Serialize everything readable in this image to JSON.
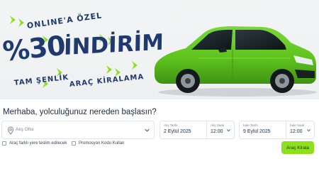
{
  "promo": {
    "line_top": "ONLINE'A ÖZEL",
    "percent": "%30",
    "word": "İNDİRİM",
    "line_bottom_left": "TAM ŞENLİK",
    "line_bottom_right": "ARAÇ KİRALAMA"
  },
  "booking": {
    "greeting": "Merhaba, yolculuğunuz nereden başlasın?",
    "pickup_placeholder": "Alış Ofisi",
    "pickup_date_label": "Alış Tarihi",
    "pickup_date": "2 Eylül 2025",
    "pickup_time_label": "Alış Saati",
    "pickup_time": "12:00",
    "return_date_label": "İade Tarihi",
    "return_date": "9 Eylül 2025",
    "return_time_label": "İade Saati",
    "return_time": "12:00",
    "option_different_return": "Araç farklı yere teslim edilecek",
    "option_promo_code": "Promosyon Kodu Kullan",
    "rent_button": "Araç Kirala"
  },
  "colors": {
    "navy": "#1e3a6e",
    "car_green": "#5fc31d",
    "accent_green": "#8ee01f",
    "chevron_green": "#8ee01f"
  },
  "icons": [
    "location-pin-icon",
    "chevron-down-icon"
  ]
}
